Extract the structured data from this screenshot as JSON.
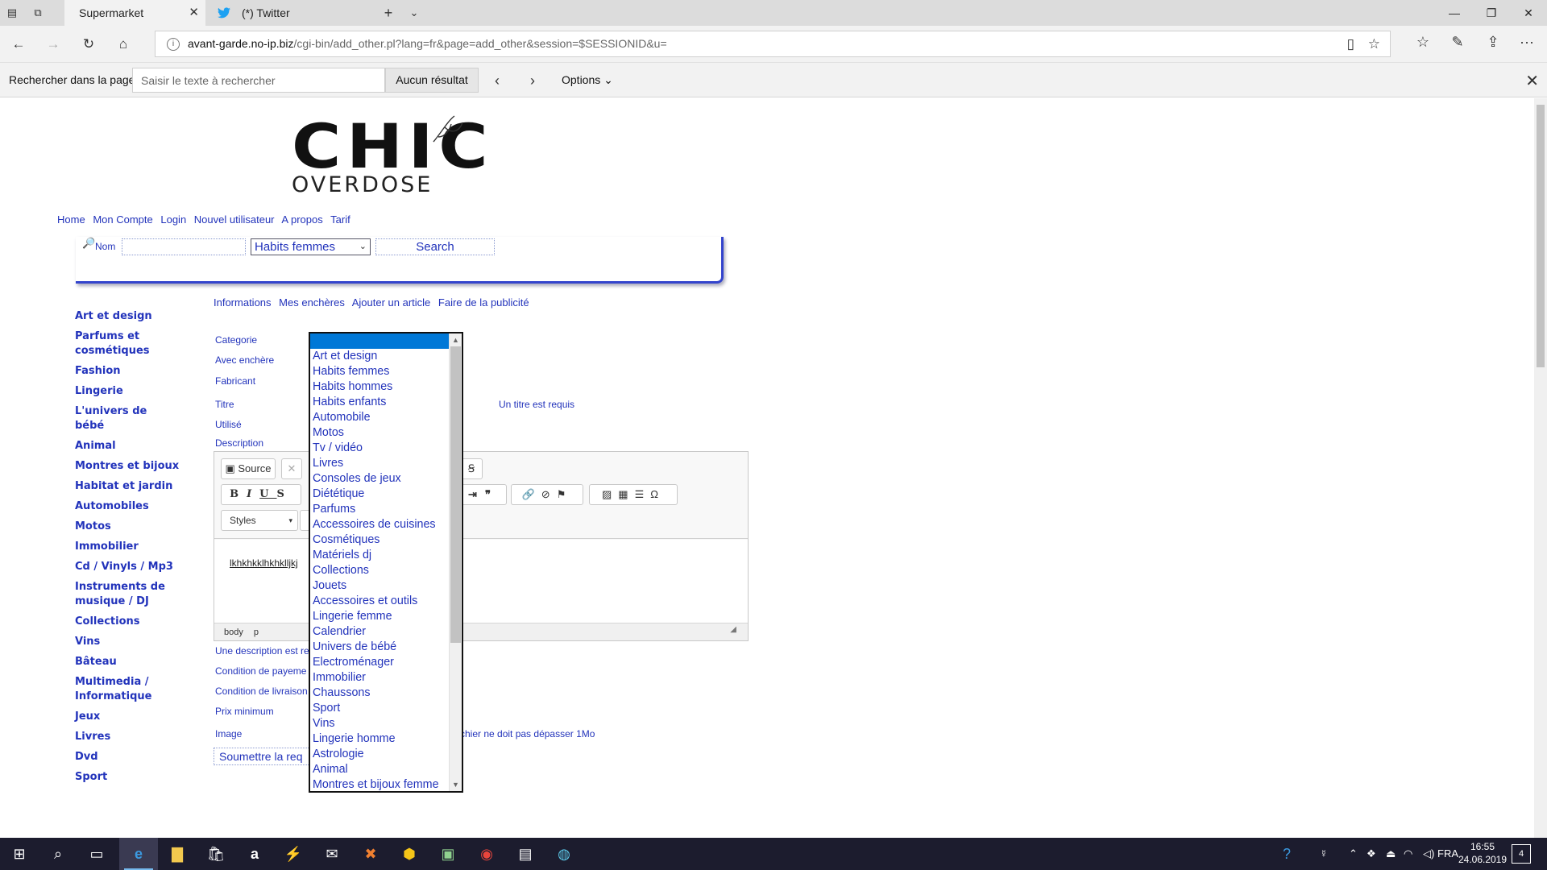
{
  "browser": {
    "tabs": [
      {
        "label": "Supermarket",
        "active": true
      },
      {
        "label": "(*) Twitter",
        "active": false
      }
    ],
    "url_host": "avant-garde.no-ip.biz",
    "url_path": "/cgi-bin/add_other.pl?lang=fr&page=add_other&session=$SESSIONID&u=",
    "find": {
      "label": "Rechercher dans la page",
      "placeholder": "Saisir le texte à rechercher",
      "result": "Aucun résultat",
      "options": "Options"
    }
  },
  "site": {
    "logo_top": "CHIC",
    "logo_bottom": "OVERDOSE",
    "topnav": [
      "Home",
      "Mon Compte",
      "Login",
      "Nouvel utilisateur",
      "A propos",
      "Tarif"
    ],
    "search": {
      "label": "Nom",
      "selected_category": "Habits femmes",
      "button": "Search"
    },
    "sidebar": [
      "Art et design",
      "Parfums et cosmétiques",
      "Fashion",
      "Lingerie",
      "L'univers de bébé",
      "Animal",
      "Montres et bijoux",
      "Habitat et jardin",
      "Automobiles",
      "Motos",
      "Immobilier",
      "Cd / Vinyls / Mp3",
      "Instruments de musique / DJ",
      "Collections",
      "Vins",
      "Bâteau",
      "Multimedia / Informatique",
      "Jeux",
      "Livres",
      "Dvd",
      "Sport"
    ],
    "subnav": [
      "Informations",
      "Mes enchères",
      "Ajouter un article",
      "Faire de la publicité"
    ]
  },
  "form": {
    "labels": {
      "categorie": "Categorie",
      "avec_enchere": "Avec enchère",
      "fabricant": "Fabricant",
      "titre": "Titre",
      "utilise": "Utilisé",
      "description": "Description",
      "description_req": "Une description est re",
      "condition_paiement": "Condition de payeme",
      "condition_livraison": "Condition de livraison",
      "prix_minimum": "Prix minimum",
      "image": "Image"
    },
    "titre_required": "Un titre est requis",
    "image_note": "chier ne doit pas dépasser 1Mo",
    "submit": "Soumettre la req",
    "editor": {
      "source": "Source",
      "styles": "Styles",
      "content": "lkhkhkklhkhklljkj",
      "status": [
        "body",
        "p"
      ]
    }
  },
  "category_dropdown": {
    "selected": "",
    "items": [
      "Art et design",
      "Habits femmes",
      "Habits hommes",
      "Habits enfants",
      "Automobile",
      "Motos",
      "Tv / vidéo",
      "Livres",
      "Consoles de jeux",
      "Diététique",
      "Parfums",
      "Accessoires de cuisines",
      "Cosmétiques",
      "Matériels dj",
      "Collections",
      "Jouets",
      "Accessoires et outils",
      "Lingerie femme",
      "Calendrier",
      "Univers de bébé",
      "Electroménager",
      "Immobilier",
      "Chaussons",
      "Sport",
      "Vins",
      "Lingerie homme",
      "Astrologie",
      "Animal",
      "Montres et bijoux femme"
    ]
  },
  "taskbar": {
    "language": "FRA",
    "time": "16:55",
    "date": "24.06.2019",
    "notifications": "4"
  },
  "colors": {
    "link_blue": "#2233bb",
    "highlight": "#0078d7",
    "taskbar": "#1c1c2e"
  }
}
